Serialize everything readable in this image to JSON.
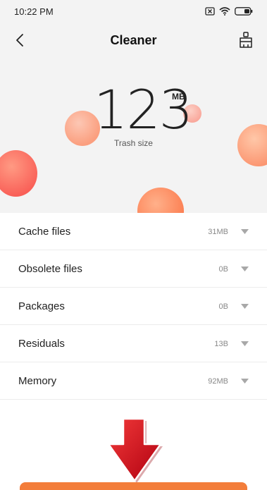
{
  "status_bar": {
    "time": "10:22 PM"
  },
  "header": {
    "title": "Cleaner"
  },
  "summary": {
    "size_value": "123",
    "size_unit": "MB",
    "size_label": "Trash size"
  },
  "categories": [
    {
      "label": "Cache files",
      "value": "31MB"
    },
    {
      "label": "Obsolete files",
      "value": "0B"
    },
    {
      "label": "Packages",
      "value": "0B"
    },
    {
      "label": "Residuals",
      "value": "13B"
    },
    {
      "label": "Memory",
      "value": "92MB"
    }
  ],
  "colors": {
    "accent": "#f37d3a",
    "arrow_red": "#d0111b"
  },
  "icons": {
    "status": [
      "sim-card-x-icon",
      "wifi-icon",
      "battery-icon"
    ],
    "back": "back-chevron-icon",
    "clean_tool": "broom-icon",
    "expand": "caret-down-icon",
    "pointer": "red-down-arrow-icon"
  }
}
